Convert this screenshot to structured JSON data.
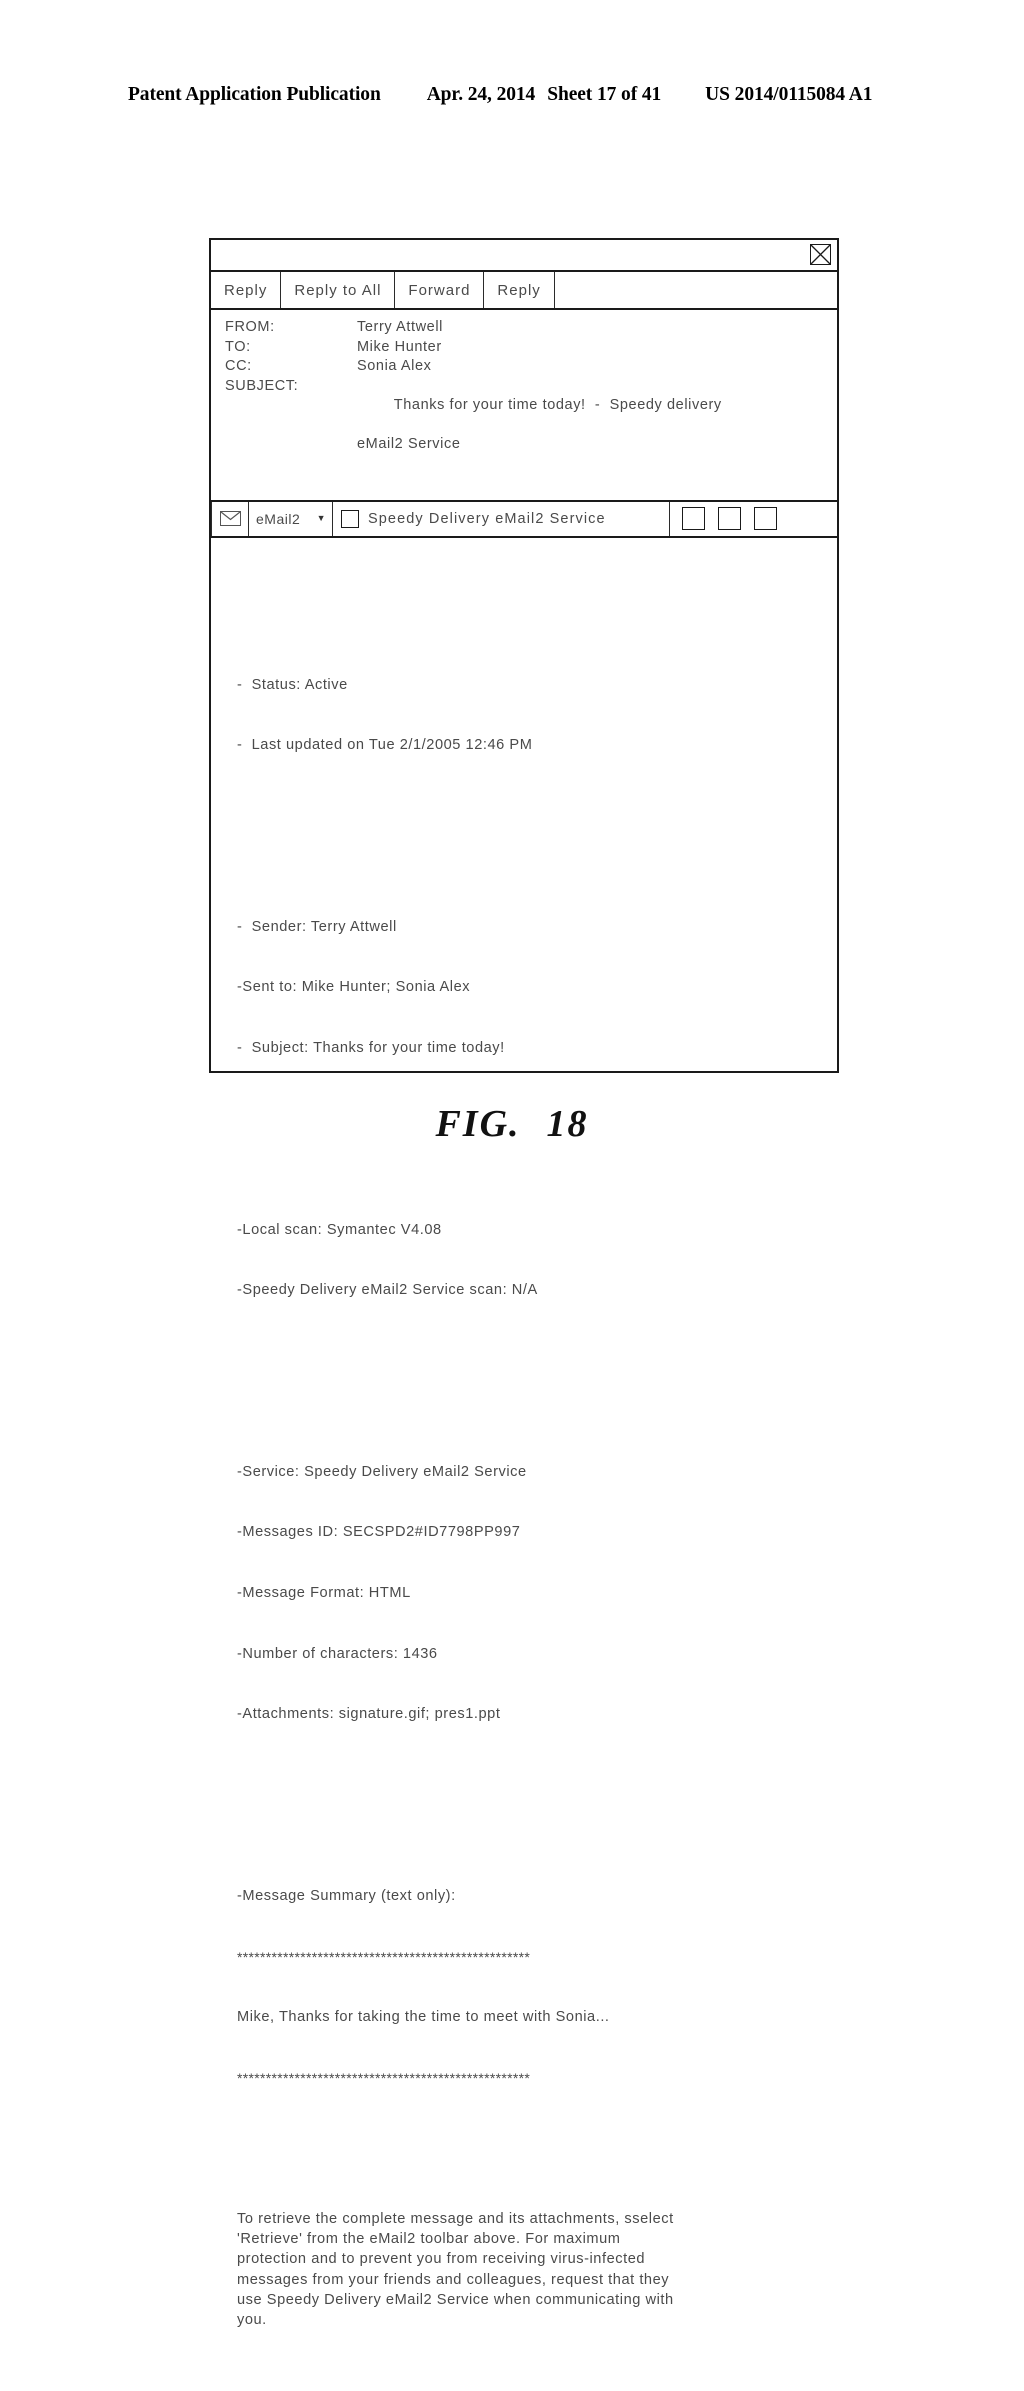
{
  "patent_header": {
    "publication": "Patent Application Publication",
    "date": "Apr. 24, 2014",
    "sheet": "Sheet 17 of 41",
    "number": "US 2014/0115084 A1"
  },
  "figure": {
    "label": "FIG.",
    "number": "18"
  },
  "window": {
    "close_icon": "close-x-box-icon",
    "toolbar": {
      "buttons": [
        {
          "label": "Reply",
          "name": "reply-button"
        },
        {
          "label": "Reply to All",
          "name": "reply-to-all-button"
        },
        {
          "label": "Forward",
          "name": "forward-button"
        },
        {
          "label": "Reply",
          "name": "reply-button-2"
        }
      ]
    },
    "message_headers": [
      {
        "label": "FROM:",
        "value": "Terry Attwell"
      },
      {
        "label": "TO:",
        "value": "Mike Hunter"
      },
      {
        "label": "CC:",
        "value": "Sonia Alex"
      },
      {
        "label": "SUBJECT:",
        "value": "Thanks for your time today!  -  Speedy delivery",
        "value_line2": "eMail2 Service"
      }
    ],
    "email2_bar": {
      "envelope_icon": "envelope-icon",
      "select_value": "eMail2",
      "select_caret": "▼",
      "checkbox_checked": false,
      "checkbox_label": "Speedy  Delivery  eMail2  Service",
      "blank_buttons": [
        "",
        "",
        ""
      ]
    },
    "body": {
      "status_block": [
        "-  Status: Active",
        "-  Last updated on Tue 2/1/2005 12:46 PM"
      ],
      "sender_block": [
        "-  Sender: Terry Attwell",
        "-Sent to: Mike Hunter; Sonia Alex",
        "-  Subject: Thanks for your time today!"
      ],
      "scan_block": [
        "-Local scan: Symantec V4.08",
        "-Speedy Delivery eMail2 Service scan: N/A"
      ],
      "service_block": [
        "-Service: Speedy Delivery eMail2 Service",
        "-Messages ID: SECSPD2#ID7798PP997",
        "-Message Format: HTML",
        "-Number of characters: 1436",
        "-Attachments: signature.gif; pres1.ppt"
      ],
      "summary_block": [
        "-Message Summary (text only):",
        "***************************************************",
        "Mike, Thanks for taking the time to meet with Sonia...",
        "***************************************************"
      ],
      "closing_paragraph": [
        "To retrieve the complete message and its attachments, sselect",
        "'Retrieve' from the eMail2 toolbar above. For maximum",
        "protection and to prevent you from receiving virus-infected",
        "messages from your friends and colleagues, request that they",
        "use Speedy Delivery eMail2 Service when communicating with",
        "you."
      ]
    }
  }
}
